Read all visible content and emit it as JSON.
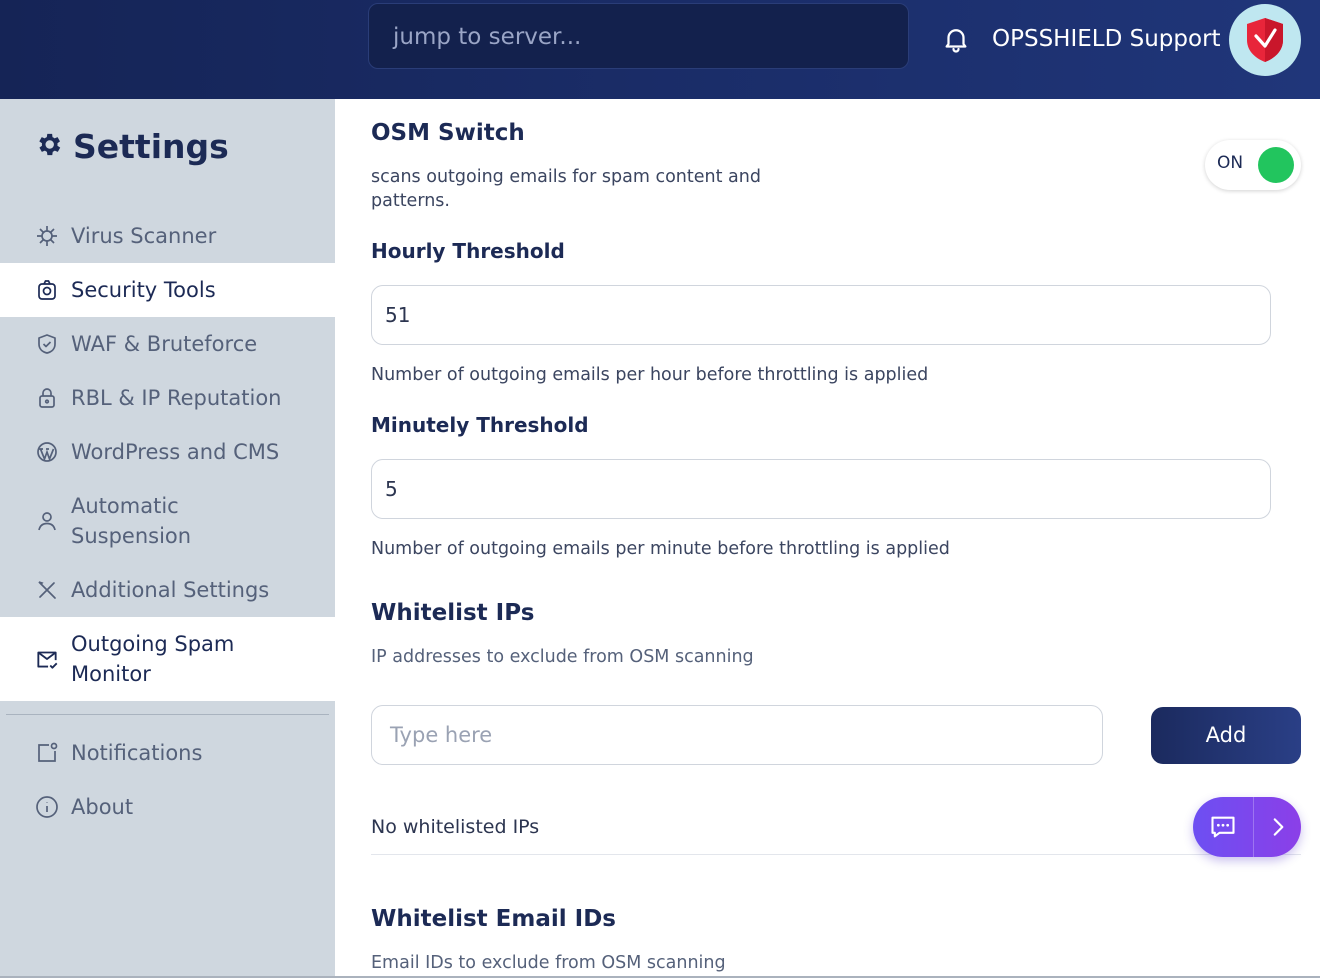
{
  "header": {
    "search_placeholder": "jump to server...",
    "user_name": "OPSSHIELD Support"
  },
  "sidebar": {
    "title": "Settings",
    "items": [
      {
        "label": "Virus Scanner"
      },
      {
        "label": "Security Tools"
      },
      {
        "label": "WAF & Bruteforce"
      },
      {
        "label": "RBL & IP Reputation"
      },
      {
        "label": "WordPress and CMS"
      },
      {
        "label": "Automatic",
        "label2": "Suspension"
      },
      {
        "label": "Additional Settings"
      },
      {
        "label": "Outgoing Spam",
        "label2": "Monitor"
      },
      {
        "label": "Notifications"
      },
      {
        "label": "About"
      }
    ]
  },
  "main": {
    "osm_title": "OSM Switch",
    "osm_desc_line1": "scans outgoing emails for spam content and",
    "osm_desc_line2": "patterns.",
    "osm_toggle_label": "ON",
    "hourly_title": "Hourly Threshold",
    "hourly_value": "51",
    "hourly_desc": "Number of outgoing emails per hour before throttling is applied",
    "minutely_title": "Minutely Threshold",
    "minutely_value": "5",
    "minutely_desc": "Number of outgoing emails per minute before throttling is applied",
    "whitelist_ips_title": "Whitelist IPs",
    "whitelist_ips_desc": "IP addresses to exclude from OSM scanning",
    "ip_input_placeholder": "Type here",
    "add_label": "Add",
    "no_ips": "No whitelisted IPs",
    "whitelist_email_title": "Whitelist Email IDs",
    "whitelist_email_desc": "Email IDs to exclude from OSM scanning"
  },
  "colors": {
    "header_bg": "#1b2e6b",
    "sidebar_bg": "#cfd7df",
    "toggle_on": "#22c55e",
    "chat_widget": "#7c4ff0"
  }
}
